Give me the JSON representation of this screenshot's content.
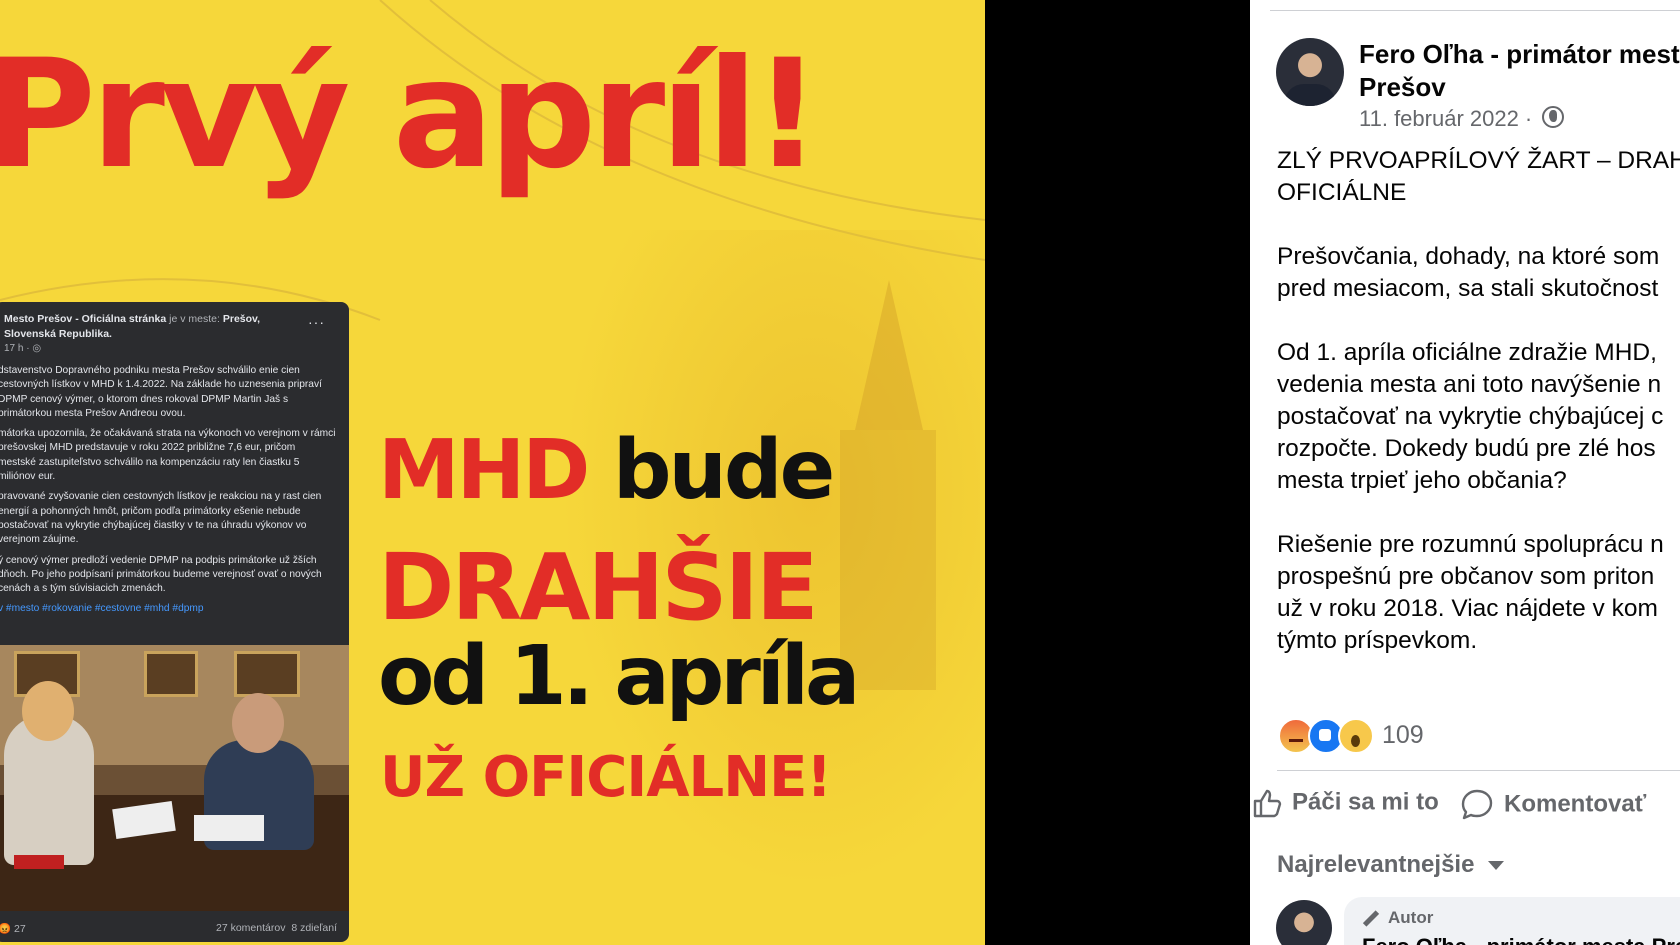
{
  "image": {
    "headline": "Prvý apríl!",
    "line1_red": "MHD",
    "line1_black": "bude",
    "line2": "DRAHŠIE",
    "line3": "od 1. apríla",
    "line4": "UŽ  OFICIÁLNE!",
    "colors": {
      "background": "#f6d73a",
      "red": "#e22d27",
      "black": "#111111"
    }
  },
  "embedded_post": {
    "page_name": "Mesto Prešov - Oficiálna stránka",
    "location_prefix": "je v meste:",
    "location": "Prešov, Slovenská Republika.",
    "time": "17 h · ",
    "more": "···",
    "paragraphs": [
      "dstavenstvo Dopravného podniku mesta Prešov schválilo enie cien cestovných lístkov v MHD k 1.4.2022. Na základe ho uznesenia pripraví DPMP cenový výmer, o ktorom dnes rokoval DPMP Martin Jaš s primátorkou mesta Prešov Andreou ovou.",
      "mátorka upozornila, že očakávaná strata na výkonoch vo verejnom v rámci prešovskej MHD predstavuje v roku 2022 približne 7,6 eur, pričom mestské zastupiteľstvo schválilo na kompenzáciu raty len čiastku 5 miliónov eur.",
      "pravované zvyšovanie cien cestovných lístkov je reakciou na y rast cien energií a pohonných hmôt, pričom podľa primátorky ešenie nebude postačovať na vykrytie chýbajúcej čiastky v te na úhradu výkonov vo verejnom záujme.",
      "ý cenový výmer predloží vedenie DPMP na podpis primátorke už žších dňoch. Po jeho podpísaní primátorkou budeme verejnosť ovať o nových cenách a s tým súvisiacich zmenách."
    ],
    "hashtags": "v #mesto #rokovanie #cestovne #mhd #dpmp",
    "reaction_count": "27",
    "comments": "27 komentárov",
    "shares": "8 zdieľaní"
  },
  "post": {
    "author": "Fero Oľha - primátor mesta",
    "author_line2": "Prešov",
    "date": "11. február 2022 · ",
    "privacy_icon": "globe-icon",
    "body": [
      [
        "ZLÝ PRVOAPRÍLOVÝ ŽART – DRAH",
        "OFICIÁLNE"
      ],
      [
        "Prešovčania, dohady, na ktoré som",
        "pred mesiacom, sa stali skutočnost"
      ],
      [
        "Od 1. apríla oficiálne zdražie MHD,",
        "vedenia mesta ani toto navýšenie n",
        "postačovať na vykrytie chýbajúcej c",
        "rozpočte. Dokedy budú pre zlé hos",
        "mesta trpieť jeho občania?"
      ],
      [
        "Riešenie pre rozumnú spoluprácu n",
        "prospešnú pre občanov som priton",
        "už v roku 2018. Viac nájdete v kom",
        "týmto príspevkom."
      ]
    ],
    "reaction_count": "109",
    "reactions": [
      "angry-icon",
      "like-icon",
      "wow-icon"
    ],
    "actions": {
      "like": "Páči sa mi to",
      "comment": "Komentovať"
    },
    "sort_label": "Najrelevantnejšie",
    "comment_badge": "Autor",
    "comment_author": "Fero Oľha - primátor mesta Prešov"
  }
}
